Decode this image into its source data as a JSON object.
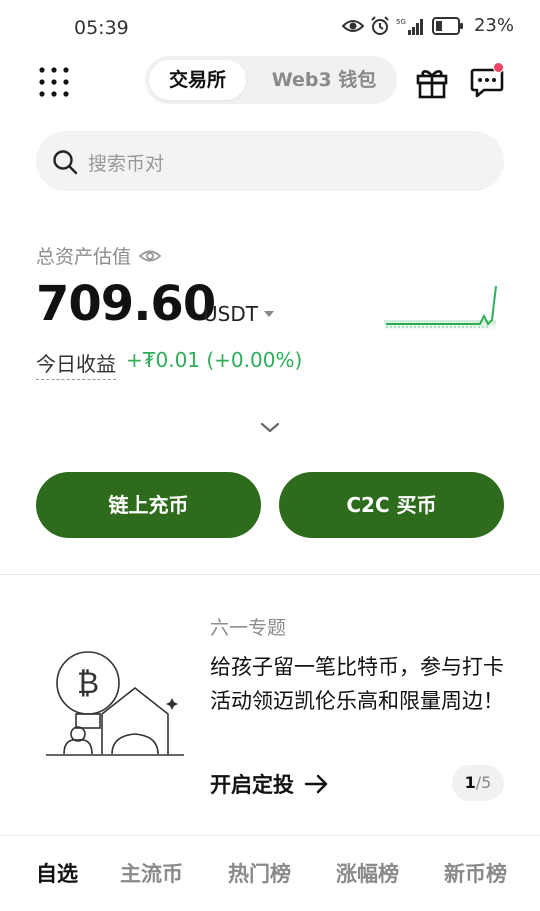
{
  "status_bar": {
    "time": "05:39",
    "network": "5G",
    "battery_percent": "23%",
    "icons": [
      "eye-icon",
      "alarm-icon",
      "signal-icon",
      "battery-icon"
    ]
  },
  "header": {
    "tabs": [
      {
        "label": "交易所",
        "active": true
      },
      {
        "label": "Web3 钱包",
        "active": false
      }
    ],
    "icons": [
      "grid-menu-icon",
      "gift-icon",
      "chat-icon"
    ],
    "notification_dot_color": "#ef4466"
  },
  "search": {
    "placeholder": "搜索币对"
  },
  "assets": {
    "label": "总资产估值",
    "value": "709.60",
    "unit": "USDT",
    "pnl_label": "今日收益",
    "pnl_value": "+₮0.01 (+0.00%)",
    "pnl_color": "#2fae59"
  },
  "actions": {
    "onchain_deposit": "链上充币",
    "c2c_buy": "C2C 买币",
    "button_color": "#2f6b1c"
  },
  "promo": {
    "tag": "六一专题",
    "text": "给孩子留一笔比特币，参与打卡活动领迈凯伦乐高和限量周边！",
    "cta": "开启定投",
    "page_current": "1",
    "page_total": "/5"
  },
  "market_tabs": [
    {
      "label": "自选",
      "active": true
    },
    {
      "label": "主流币",
      "active": false
    },
    {
      "label": "热门榜",
      "active": false
    },
    {
      "label": "涨幅榜",
      "active": false
    },
    {
      "label": "新币榜",
      "active": false
    }
  ]
}
